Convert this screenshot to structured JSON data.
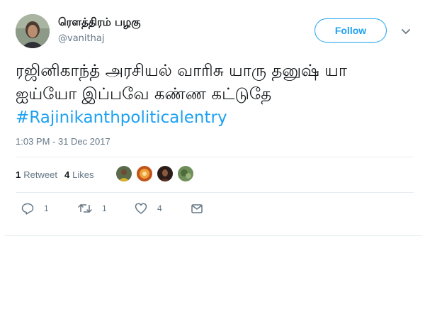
{
  "author": {
    "display_name": "ரௌத்திரம் பழகு",
    "handle": "@vanithaj"
  },
  "follow_label": "Follow",
  "tweet": {
    "text": "ரஜினிகாந்த் அரசியல் வாரிசு யாரு தனுஷ் யா ஐய்யோ இப்பவே கண்ண கட்டுதே",
    "hashtag": "#Rajinikanthpoliticalentry",
    "timestamp": "1:03 PM - 31 Dec 2017"
  },
  "stats": {
    "retweets_count": "1",
    "retweets_label": "Retweet",
    "likes_count": "4",
    "likes_label": "Likes"
  },
  "actions": {
    "reply_count": "1",
    "retweet_count": "1",
    "like_count": "4"
  },
  "colors": {
    "accent": "#1da1f2",
    "secondary_text": "#657786",
    "primary_text": "#14171a",
    "divider": "#e6ecf0"
  },
  "icons": {
    "menu": "chevron-down-icon",
    "reply": "reply-icon",
    "retweet": "retweet-icon",
    "like": "heart-icon",
    "message": "envelope-icon"
  }
}
